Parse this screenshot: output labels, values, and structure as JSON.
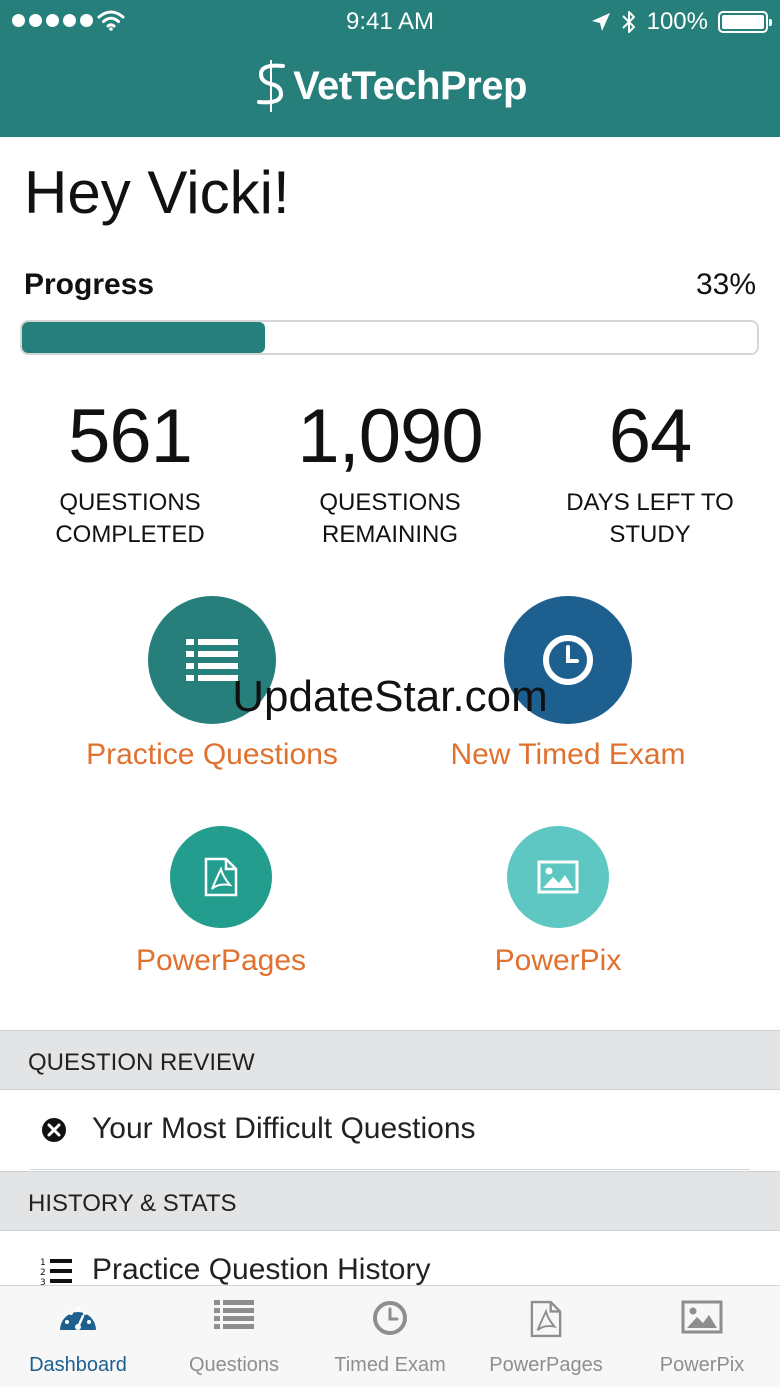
{
  "status_bar": {
    "time": "9:41 AM",
    "battery": "100%"
  },
  "app": {
    "logo_text": "VetTechPrep"
  },
  "greeting": "Hey Vicki!",
  "progress": {
    "label": "Progress",
    "percent_text": "33%",
    "value": 0.33
  },
  "stats": [
    {
      "number": "561",
      "label_line1": "QUESTIONS",
      "label_line2": "COMPLETED"
    },
    {
      "number": "1,090",
      "label_line1": "QUESTIONS",
      "label_line2": "REMAINING"
    },
    {
      "number": "64",
      "label_line1": "DAYS LEFT TO",
      "label_line2": "STUDY"
    }
  ],
  "features": {
    "practice_questions": {
      "label": "Practice Questions",
      "color": "#267f7a",
      "icon": "list-icon"
    },
    "new_timed_exam": {
      "label": "New Timed Exam",
      "color": "#1d5f8f",
      "icon": "clock-icon"
    },
    "power_pages": {
      "label": "PowerPages",
      "color": "#239e8e",
      "icon": "pdf-icon"
    },
    "power_pix": {
      "label": "PowerPix",
      "color": "#5ec7c1",
      "icon": "image-icon"
    }
  },
  "watermark": "UpdateStar.com",
  "sections": {
    "question_review": {
      "header": "QUESTION REVIEW",
      "items": [
        {
          "label": "Your Most Difficult Questions",
          "icon": "close-circle-icon"
        }
      ]
    },
    "history_stats": {
      "header": "HISTORY & STATS",
      "items": [
        {
          "label": "Practice Question History",
          "icon": "numbered-list-icon"
        }
      ]
    }
  },
  "tabs": [
    {
      "label": "Dashboard",
      "icon": "dashboard-icon",
      "active": true
    },
    {
      "label": "Questions",
      "icon": "list-icon",
      "active": false
    },
    {
      "label": "Timed Exam",
      "icon": "clock-icon",
      "active": false
    },
    {
      "label": "PowerPages",
      "icon": "pdf-icon",
      "active": false
    },
    {
      "label": "PowerPix",
      "icon": "image-icon",
      "active": false
    }
  ],
  "colors": {
    "brand": "#267f7a",
    "accent_orange": "#e0712f",
    "tab_active": "#1d5f8f",
    "tab_inactive": "#8e8e8e"
  }
}
